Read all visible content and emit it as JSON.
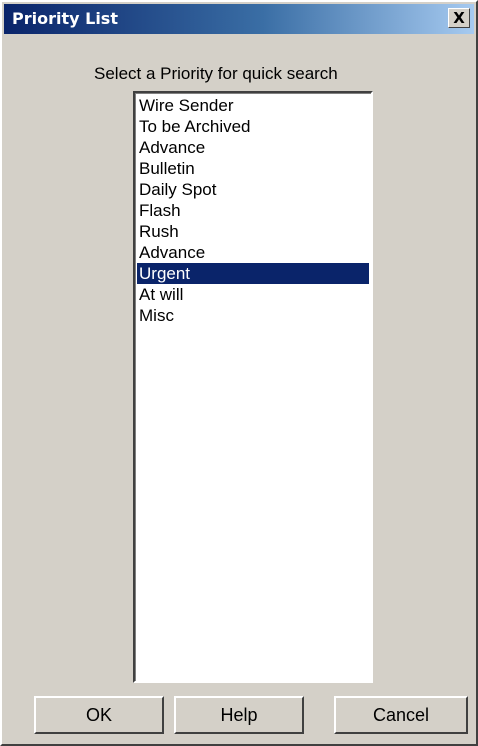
{
  "window": {
    "title": "Priority List",
    "close_glyph": "X"
  },
  "prompt": "Select a Priority for quick search",
  "list": {
    "items": [
      "Wire Sender",
      "To be Archived",
      "Advance",
      "Bulletin",
      "Daily Spot",
      "Flash",
      "Rush",
      "Advance",
      "Urgent",
      "At will",
      "Misc"
    ],
    "selected_index": 8
  },
  "buttons": {
    "ok": "OK",
    "help": "Help",
    "cancel": "Cancel"
  },
  "colors": {
    "dialog_face": "#d4d0c8",
    "titlebar": "#0a246a",
    "selection": "#0a246a"
  }
}
